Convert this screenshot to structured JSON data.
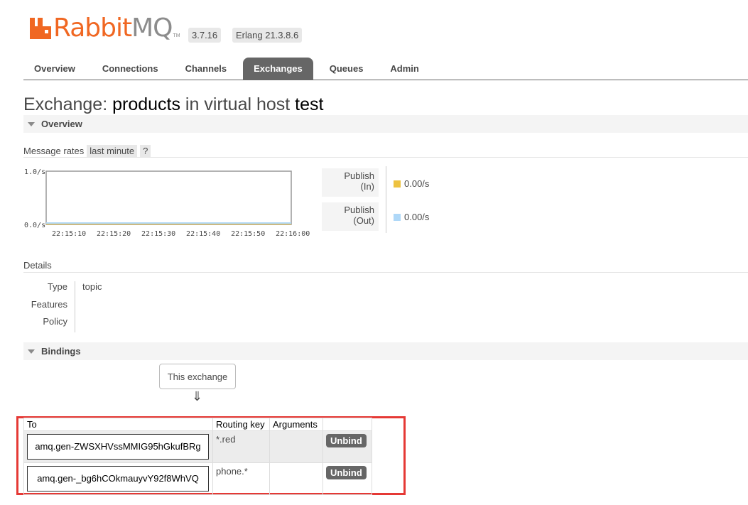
{
  "header": {
    "logo_rabbit": "Rabbit",
    "logo_mq": "MQ",
    "logo_tm": "TM",
    "version": "3.7.16",
    "erlang": "Erlang 21.3.8.6"
  },
  "tabs": [
    {
      "label": "Overview"
    },
    {
      "label": "Connections"
    },
    {
      "label": "Channels"
    },
    {
      "label": "Exchanges",
      "active": true
    },
    {
      "label": "Queues"
    },
    {
      "label": "Admin"
    }
  ],
  "title": {
    "prefix": "Exchange: ",
    "name": "products",
    "middle": " in virtual host ",
    "vhost": "test"
  },
  "overview": {
    "heading": "Overview",
    "message_rates_label": "Message rates",
    "range": "last minute",
    "help": "?",
    "legend": [
      {
        "label_line1": "Publish",
        "label_line2": "(In)",
        "value": "0.00/s",
        "color": "#edc240"
      },
      {
        "label_line1": "Publish",
        "label_line2": "(Out)",
        "value": "0.00/s",
        "color": "#afd8f8"
      }
    ]
  },
  "chart_data": {
    "type": "line",
    "x": [
      "22:15:10",
      "22:15:20",
      "22:15:30",
      "22:15:40",
      "22:15:50",
      "22:16:00"
    ],
    "series": [
      {
        "name": "Publish (In)",
        "values": [
          0,
          0,
          0,
          0,
          0,
          0
        ],
        "color": "#edc240"
      },
      {
        "name": "Publish (Out)",
        "values": [
          0,
          0,
          0,
          0,
          0,
          0
        ],
        "color": "#afd8f8"
      }
    ],
    "ytick_labels": [
      "1.0/s",
      "0.0/s"
    ],
    "ylim": [
      0,
      1
    ],
    "grid": false
  },
  "details": {
    "heading": "Details",
    "rows": [
      {
        "key": "Type",
        "value": "topic"
      },
      {
        "key": "Features",
        "value": ""
      },
      {
        "key": "Policy",
        "value": ""
      }
    ]
  },
  "bindings": {
    "heading": "Bindings",
    "this_exchange": "This exchange",
    "arrow": "⇓",
    "columns": [
      "To",
      "Routing key",
      "Arguments",
      ""
    ],
    "rows": [
      {
        "to": "amq.gen-ZWSXHVssMMIG95hGkufBRg",
        "routing_key": "*.red",
        "arguments": "",
        "action": "Unbind"
      },
      {
        "to": "amq.gen-_bg6hCOkmauyvY92f8WhVQ",
        "routing_key": "phone.*",
        "arguments": "",
        "action": "Unbind"
      }
    ]
  },
  "highlight_color": "#e53935"
}
